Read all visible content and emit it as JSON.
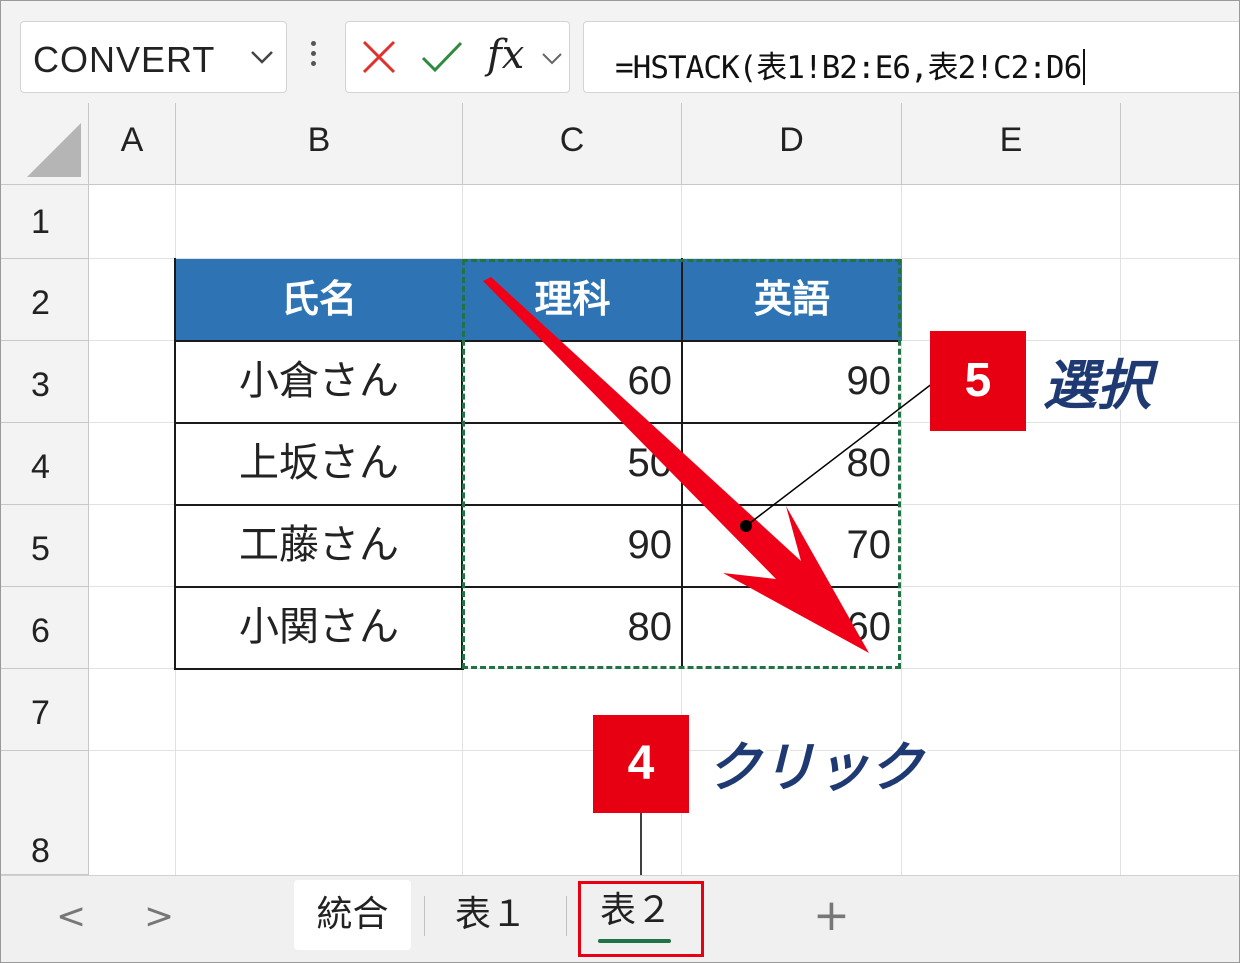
{
  "formula_bar": {
    "name_box": "CONVERT",
    "cancel_icon": "x-icon",
    "enter_icon": "check-icon",
    "fx_label": "fx",
    "formula": "=HSTACK(表1!B2:E6,表2!C2:D6"
  },
  "columns": [
    "A",
    "B",
    "C",
    "D",
    "E"
  ],
  "rows": [
    "1",
    "2",
    "3",
    "4",
    "5",
    "6",
    "7",
    "8"
  ],
  "table": {
    "headers": [
      "氏名",
      "理科",
      "英語"
    ],
    "rows": [
      {
        "name": "小倉さん",
        "science": "60",
        "english": "90"
      },
      {
        "name": "上坂さん",
        "science": "50",
        "english": "80"
      },
      {
        "name": "工藤さん",
        "science": "90",
        "english": "70"
      },
      {
        "name": "小関さん",
        "science": "80",
        "english": "60"
      }
    ],
    "header_color": "#2e74b5",
    "selection_color": "#217346"
  },
  "sheet_tabs": {
    "prev": "<",
    "next": ">",
    "tabs": [
      "統合",
      "表１",
      "表２"
    ],
    "active_tab": "表２",
    "add": "+"
  },
  "annotations": {
    "step5": {
      "number": "5",
      "label": "選択"
    },
    "step4": {
      "number": "4",
      "label": "クリック"
    },
    "accent_color": "#e60012"
  }
}
